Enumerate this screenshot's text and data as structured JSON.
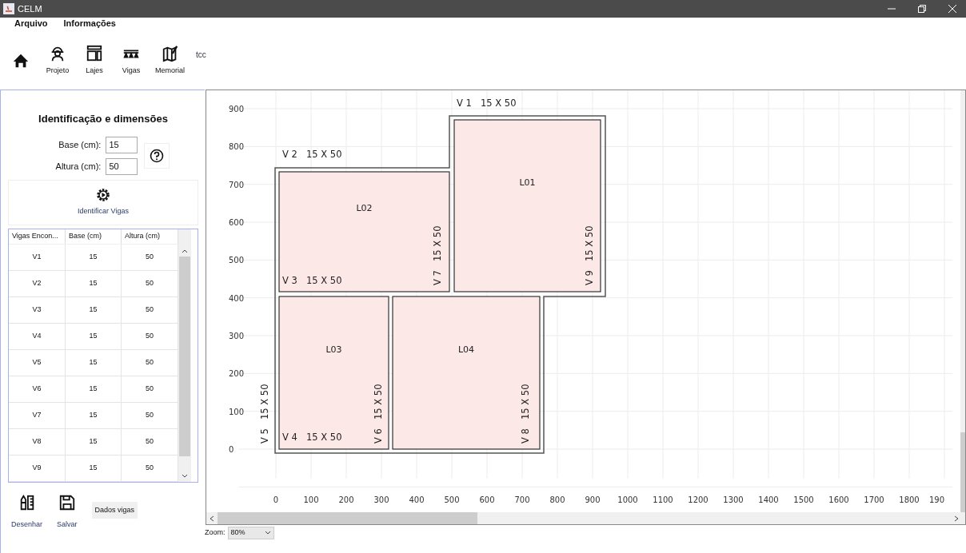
{
  "window": {
    "title": "CELM"
  },
  "menu": [
    "Arquivo",
    "Informações"
  ],
  "toolbar": [
    {
      "kind": "home"
    },
    {
      "kind": "worker",
      "label": "Projeto"
    },
    {
      "kind": "slab",
      "label": "Lajes"
    },
    {
      "kind": "beam",
      "label": "Vigas"
    },
    {
      "kind": "map",
      "label": "Memorial"
    }
  ],
  "project_name": "tcc",
  "form": {
    "title": "Identificação e dimensões",
    "fields": [
      {
        "label": "Base  (cm):",
        "value": "15"
      },
      {
        "label": "Altura (cm):",
        "value": "50"
      }
    ],
    "action": "Identificar Vigas"
  },
  "table": {
    "columns": [
      "Vigas Encon...",
      "Base (cm)",
      "Altura (cm)"
    ],
    "rows": [
      [
        "V1",
        "15",
        "50"
      ],
      [
        "V2",
        "15",
        "50"
      ],
      [
        "V3",
        "15",
        "50"
      ],
      [
        "V4",
        "15",
        "50"
      ],
      [
        "V5",
        "15",
        "50"
      ],
      [
        "V6",
        "15",
        "50"
      ],
      [
        "V7",
        "15",
        "50"
      ],
      [
        "V8",
        "15",
        "50"
      ],
      [
        "V9",
        "15",
        "50"
      ]
    ]
  },
  "bottom_buttons": [
    {
      "kind": "draw",
      "label": "Desenhar"
    },
    {
      "kind": "save",
      "label": "Salvar"
    }
  ],
  "data_tab": "Dados vigas",
  "plan": {
    "y_ticks": [
      "900",
      "800",
      "700",
      "600",
      "500",
      "400",
      "300",
      "200",
      "100",
      "0"
    ],
    "x_ticks": [
      "0",
      "100",
      "200",
      "300",
      "400",
      "500",
      "600",
      "700",
      "800",
      "900",
      "1000",
      "1100",
      "1200",
      "1300",
      "1400",
      "1500",
      "1600",
      "1700",
      "1800",
      "190"
    ],
    "slabs": [
      "L01",
      "L02",
      "L03",
      "L04"
    ],
    "beams": [
      {
        "name": "V 1",
        "section": "15 X 50",
        "kind": "horizontal"
      },
      {
        "name": "V 2",
        "section": "15 X 50",
        "kind": "horizontal"
      },
      {
        "name": "V 3",
        "section": "15 X 50",
        "kind": "horizontal"
      },
      {
        "name": "V 4",
        "section": "15 X 50",
        "kind": "horizontal"
      },
      {
        "name": "V 5",
        "section": "15 X 50",
        "kind": "vertical"
      },
      {
        "name": "V 6",
        "section": "15 X 50",
        "kind": "vertical"
      },
      {
        "name": "V 7",
        "section": "15 X 50",
        "kind": "vertical"
      },
      {
        "name": "V 8",
        "section": "15 X 50",
        "kind": "vertical"
      },
      {
        "name": "V 9",
        "section": "15 X 50",
        "kind": "vertical"
      }
    ]
  },
  "zoom": {
    "label": "Zoom:",
    "value": "80%"
  }
}
